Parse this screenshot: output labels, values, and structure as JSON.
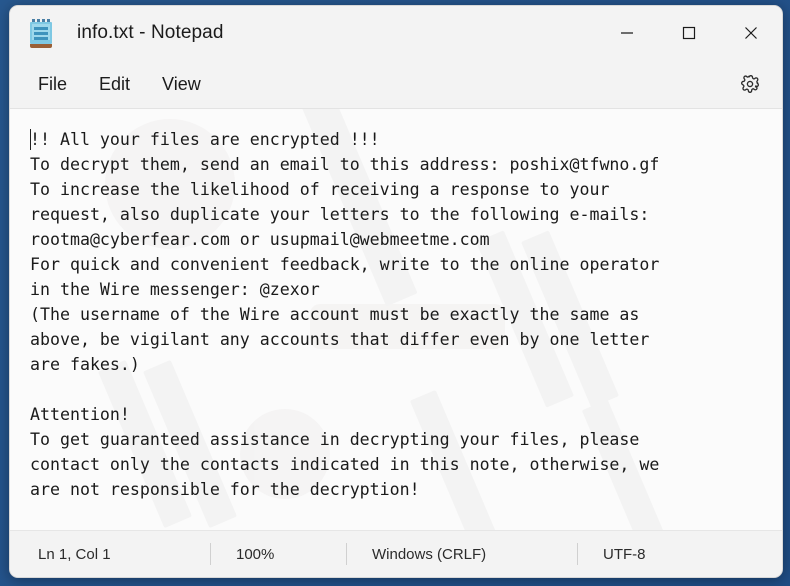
{
  "desktop": {
    "background_color": "#24578f"
  },
  "window": {
    "title": "info.txt - Notepad",
    "icon": "notepad-icon",
    "controls": {
      "minimize_label": "Minimize",
      "maximize_label": "Maximize",
      "close_label": "Close"
    }
  },
  "menubar": {
    "items": [
      {
        "label": "File"
      },
      {
        "label": "Edit"
      },
      {
        "label": "View"
      }
    ],
    "settings_icon": "gear-icon",
    "settings_label": "Settings"
  },
  "editor": {
    "content": "!! All your files are encrypted !!!\nTo decrypt them, send an email to this address: poshix@tfwno.gf\nTo increase the likelihood of receiving a response to your\nrequest, also duplicate your letters to the following e-mails:\nrootma@cyberfear.com or usupmail@webmeetme.com\nFor quick and convenient feedback, write to the online operator\nin the Wire messenger: @zexor\n(The username of the Wire account must be exactly the same as\nabove, be vigilant any accounts that differ even by one letter\nare fakes.)\n\nAttention!\nTo get guaranteed assistance in decrypting your files, please\ncontact only the contacts indicated in this note, otherwise, we\nare not responsible for the decryption!",
    "lines": [
      "!! All your files are encrypted !!!",
      "To decrypt them, send an email to this address: poshix@tfwno.gf",
      "To increase the likelihood of receiving a response to your",
      "request, also duplicate your letters to the following e-mails:",
      "rootma@cyberfear.com or usupmail@webmeetme.com",
      "For quick and convenient feedback, write to the online operator",
      "in the Wire messenger: @zexor",
      "(The username of the Wire account must be exactly the same as",
      "above, be vigilant any accounts that differ even by one letter",
      "are fakes.)",
      "",
      "Attention!",
      "To get guaranteed assistance in decrypting your files, please",
      "contact only the contacts indicated in this note, otherwise, we",
      "are not responsible for the decryption!"
    ],
    "contacts": {
      "primary_email": "poshix@tfwno.gf",
      "secondary_emails": [
        "rootma@cyberfear.com",
        "usupmail@webmeetme.com"
      ],
      "wire_username": "@zexor"
    }
  },
  "statusbar": {
    "cursor_position": "Ln 1, Col 1",
    "zoom": "100%",
    "line_ending": "Windows (CRLF)",
    "encoding": "UTF-8"
  }
}
